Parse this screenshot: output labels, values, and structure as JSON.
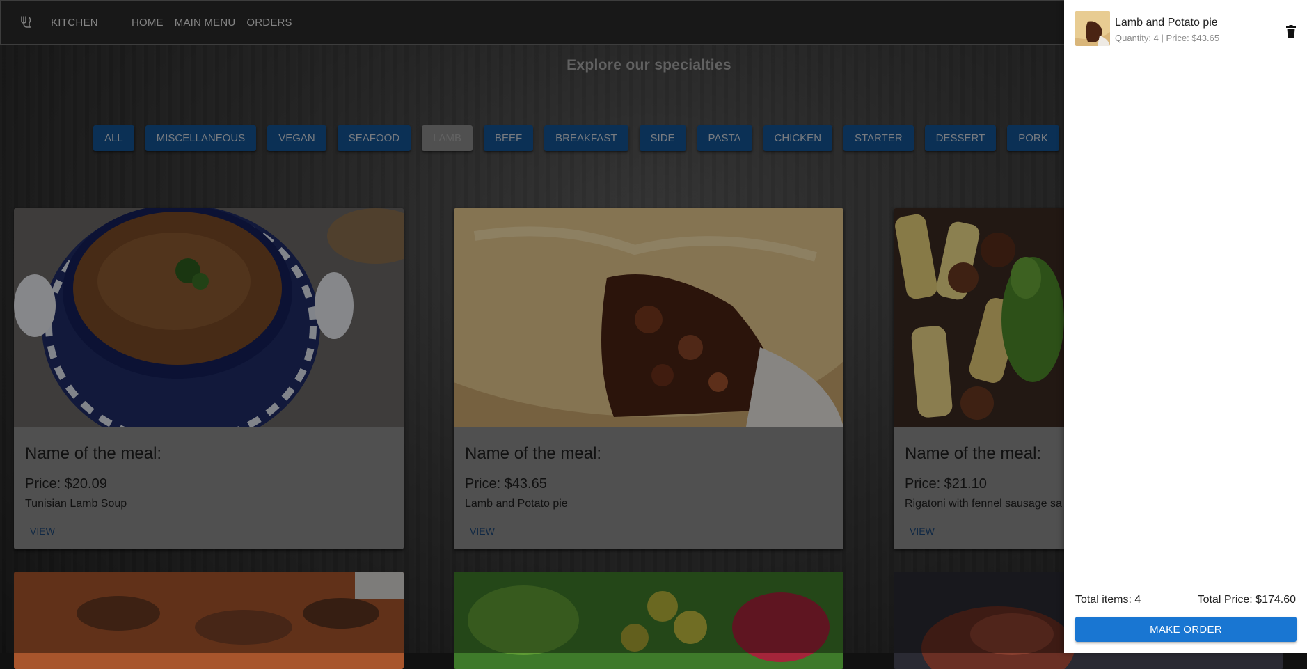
{
  "appbar": {
    "brand": "KITCHEN",
    "nav": [
      "HOME",
      "MAIN MENU",
      "ORDERS"
    ]
  },
  "page_title": "Explore our specialties",
  "categories": {
    "items": [
      "ALL",
      "MISCELLANEOUS",
      "VEGAN",
      "SEAFOOD",
      "LAMB",
      "BEEF",
      "BREAKFAST",
      "SIDE",
      "PASTA",
      "CHICKEN",
      "STARTER",
      "DESSERT",
      "PORK"
    ],
    "active": "LAMB"
  },
  "meals": [
    {
      "heading": "Name of the meal:",
      "price": "Price: $20.09",
      "name": "Tunisian Lamb Soup",
      "view": "VIEW"
    },
    {
      "heading": "Name of the meal:",
      "price": "Price: $43.65",
      "name": "Lamb and Potato pie",
      "view": "VIEW"
    },
    {
      "heading": "Name of the meal:",
      "price": "Price: $21.10",
      "name": "Rigatoni with fennel sausage sa",
      "view": "VIEW"
    }
  ],
  "cart": {
    "items": [
      {
        "name": "Lamb and Potato pie",
        "quantity_text": "Quantity: 4",
        "separator": " | ",
        "price_text": "Price: $43.65"
      }
    ],
    "total_items": "Total items: 4",
    "total_price": "Total Price: $174.60",
    "make_order": "MAKE ORDER"
  },
  "colors": {
    "accent": "#1976d2",
    "category_button": "#145493",
    "category_active": "#8b8b8b"
  }
}
